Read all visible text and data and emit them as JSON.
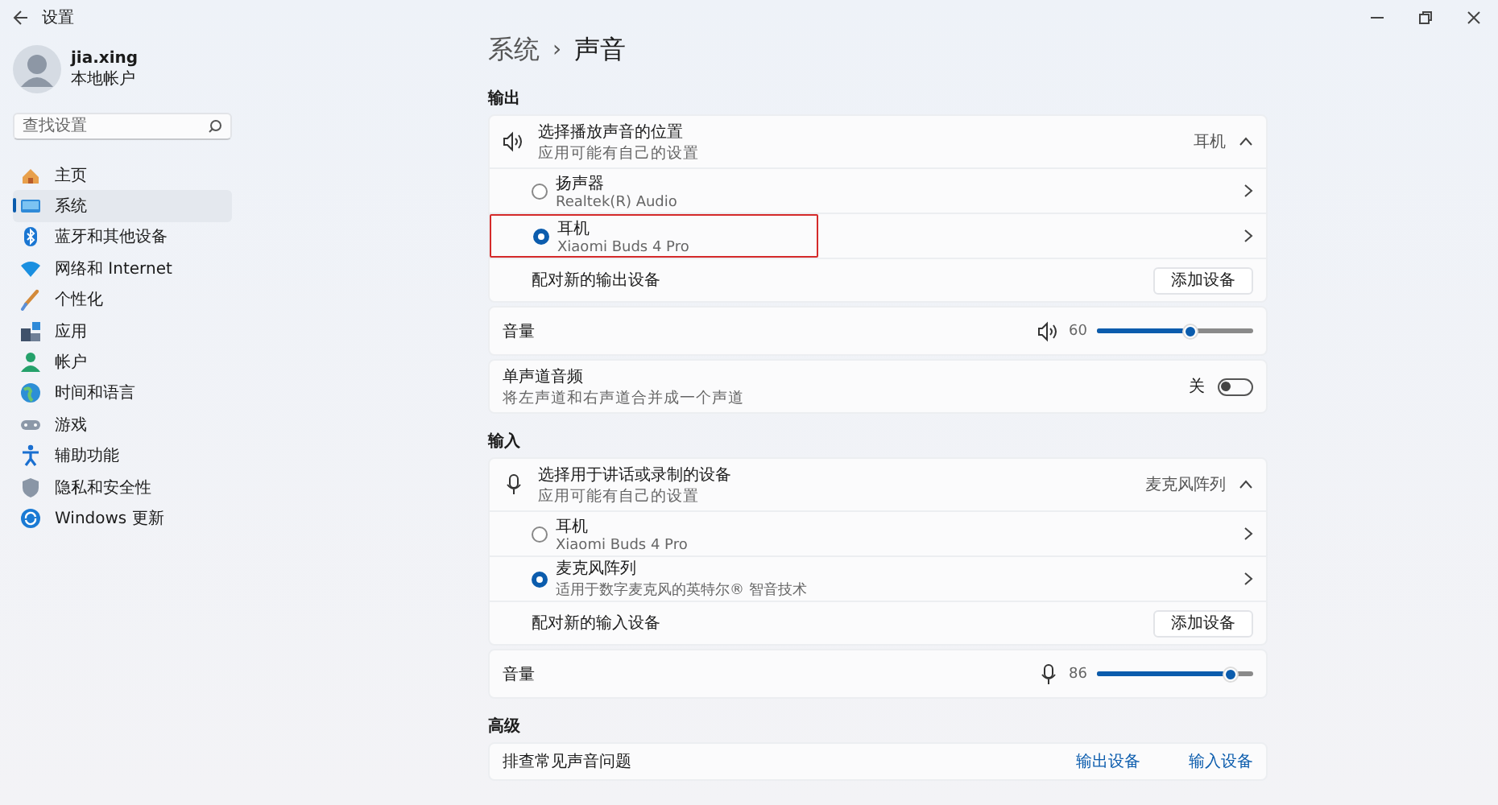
{
  "window": {
    "title": "设置"
  },
  "user": {
    "name": "jia.xing",
    "account": "本地帐户"
  },
  "search": {
    "placeholder": "查找设置"
  },
  "sidebar": {
    "items": [
      {
        "label": "主页",
        "kind": "home",
        "selected": false
      },
      {
        "label": "系统",
        "kind": "system",
        "selected": true
      },
      {
        "label": "蓝牙和其他设备",
        "kind": "bluetooth",
        "selected": false
      },
      {
        "label": "网络和 Internet",
        "kind": "network",
        "selected": false
      },
      {
        "label": "个性化",
        "kind": "brush",
        "selected": false
      },
      {
        "label": "应用",
        "kind": "apps",
        "selected": false
      },
      {
        "label": "帐户",
        "kind": "account",
        "selected": false
      },
      {
        "label": "时间和语言",
        "kind": "globe",
        "selected": false
      },
      {
        "label": "游戏",
        "kind": "gaming",
        "selected": false
      },
      {
        "label": "辅助功能",
        "kind": "accessibility",
        "selected": false
      },
      {
        "label": "隐私和安全性",
        "kind": "shield",
        "selected": false
      },
      {
        "label": "Windows 更新",
        "kind": "update",
        "selected": false
      }
    ]
  },
  "breadcrumb": {
    "parent": "系统",
    "separator": "›",
    "current": "声音"
  },
  "sections": [
    {
      "heading": "输出",
      "selector": {
        "kind": "speaker",
        "title": "选择播放声音的位置",
        "subtitle": "应用可能有自己的设置",
        "value": "耳机",
        "expanded": true
      },
      "devices": [
        {
          "name": "扬声器",
          "detail": "Realtek(R) Audio",
          "selected": false,
          "highlighted": false
        },
        {
          "name": "耳机",
          "detail": "Xiaomi Buds 4 Pro",
          "selected": true,
          "highlighted": true
        }
      ],
      "pair": {
        "label": "配对新的输出设备",
        "button": "添加设备"
      },
      "volume": {
        "label": "音量",
        "kind": "speaker",
        "reading": "60",
        "level": 0.6
      },
      "mono": {
        "title": "单声道音频",
        "subtitle": "将左声道和右声道合并成一个声道",
        "state_label": "关",
        "on": false
      }
    },
    {
      "heading": "输入",
      "selector": {
        "kind": "mic",
        "title": "选择用于讲话或录制的设备",
        "subtitle": "应用可能有自己的设置",
        "value": "麦克风阵列",
        "expanded": true
      },
      "devices": [
        {
          "name": "耳机",
          "detail": "Xiaomi Buds 4 Pro",
          "selected": false,
          "highlighted": false
        },
        {
          "name": "麦克风阵列",
          "detail": "适用于数字麦克风的英特尔® 智音技术",
          "selected": true,
          "highlighted": false
        }
      ],
      "pair": {
        "label": "配对新的输入设备",
        "button": "添加设备"
      },
      "volume": {
        "label": "音量",
        "kind": "mic",
        "reading": "86",
        "level": 0.86
      }
    }
  ],
  "advanced": {
    "heading": "高级",
    "row": {
      "title": "排查常见声音问题",
      "links": [
        "输出设备",
        "输入设备"
      ]
    }
  }
}
